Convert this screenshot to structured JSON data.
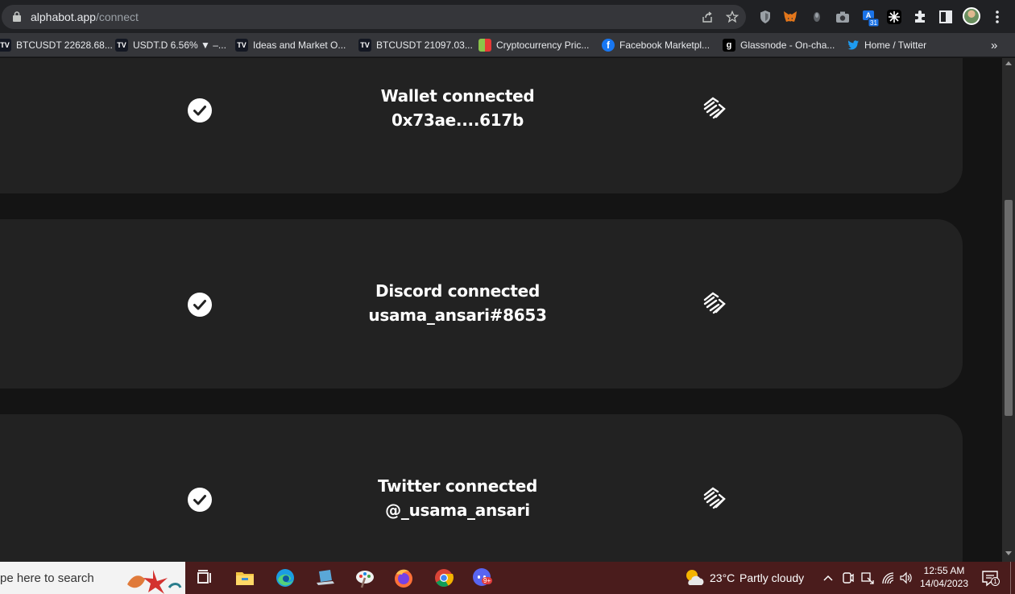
{
  "browser": {
    "url_host": "alphabot.app",
    "url_path": "/connect",
    "bookmarks": [
      {
        "label": "BTCUSDT 22628.68...",
        "icon": "tradingview-icon",
        "color": "#131722"
      },
      {
        "label": "USDT.D 6.56% ▼ –...",
        "icon": "tradingview-icon",
        "color": "#131722"
      },
      {
        "label": "Ideas and Market O...",
        "icon": "tradingview-icon",
        "color": "#131722"
      },
      {
        "label": "BTCUSDT 21097.03...",
        "icon": "tradingview-icon",
        "color": "#131722"
      },
      {
        "label": "Cryptocurrency Pric...",
        "icon": "coinmarket-icon",
        "color": "#8bc34a"
      },
      {
        "label": "Facebook Marketpl...",
        "icon": "facebook-icon",
        "color": "#1877f2"
      },
      {
        "label": "Glassnode - On-cha...",
        "icon": "glassnode-icon",
        "color": "#000000"
      },
      {
        "label": "Home / Twitter",
        "icon": "twitter-icon",
        "color": "#1d9bf0"
      }
    ],
    "overflow_label": "»"
  },
  "connections": [
    {
      "title": "Wallet connected",
      "value": "0x73ae....617b"
    },
    {
      "title": "Discord connected",
      "value": "usama_ansari#8653"
    },
    {
      "title": "Twitter connected",
      "value": "@_usama_ansari"
    }
  ],
  "taskbar": {
    "search_placeholder": "pe here to search",
    "weather": {
      "temp": "23°C",
      "condition": "Partly cloudy"
    },
    "clock": {
      "time": "12:55 AM",
      "date": "14/04/2023"
    },
    "notification_count": "1",
    "discord_badge": "9+"
  },
  "colors": {
    "page_bg": "#141414",
    "card_bg": "#222222",
    "taskbar_bg": "#4a1c1c"
  }
}
